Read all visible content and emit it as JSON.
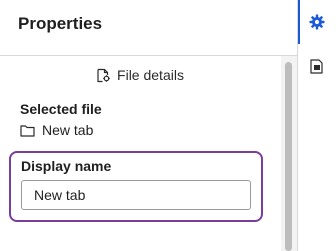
{
  "panel": {
    "title": "Properties",
    "file_details_label": "File details",
    "selected_file_label": "Selected file",
    "selected_file_name": "New tab",
    "display_name_label": "Display name",
    "display_name_value": "New tab"
  },
  "rail": {
    "items": [
      {
        "icon": "gear-icon",
        "active": true
      },
      {
        "icon": "page-properties-icon",
        "active": false
      }
    ]
  },
  "colors": {
    "accent": "#1a5ad7",
    "focus_border": "#7a3d9a"
  }
}
